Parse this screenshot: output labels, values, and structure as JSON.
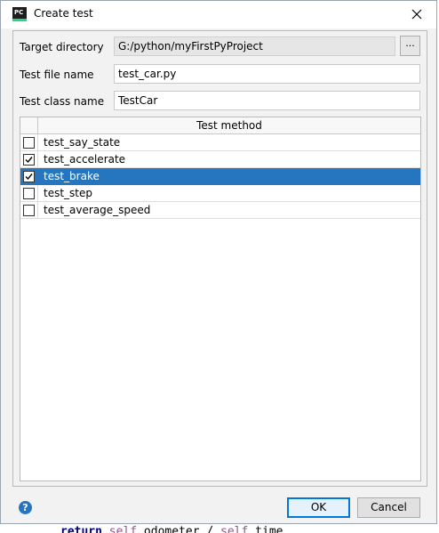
{
  "window": {
    "title": "Create test",
    "app_icon_text": "PC",
    "icon": "pycharm-icon"
  },
  "form": {
    "target_directory_label": "Target directory",
    "target_directory_value": "G:/python/myFirstPyProject",
    "browse_label": "...",
    "test_file_name_label": "Test file name",
    "test_file_name_value": "test_car.py",
    "test_class_name_label": "Test class name",
    "test_class_name_value": "TestCar"
  },
  "table": {
    "header": "Test method",
    "rows": [
      {
        "name": "test_say_state",
        "checked": false,
        "selected": false
      },
      {
        "name": "test_accelerate",
        "checked": true,
        "selected": false
      },
      {
        "name": "test_brake",
        "checked": true,
        "selected": true
      },
      {
        "name": "test_step",
        "checked": false,
        "selected": false
      },
      {
        "name": "test_average_speed",
        "checked": false,
        "selected": false
      }
    ]
  },
  "footer": {
    "help_label": "?",
    "ok_label": "OK",
    "cancel_label": "Cancel"
  },
  "background": {
    "code_keyword": "return",
    "code_self1": "self",
    "code_mid": ".odometer / ",
    "code_self2": "self",
    "code_tail": ".time"
  },
  "colors": {
    "selection": "#2675bf",
    "dialog_bg": "#f2f2f2",
    "default_button_border": "#0078d7"
  }
}
